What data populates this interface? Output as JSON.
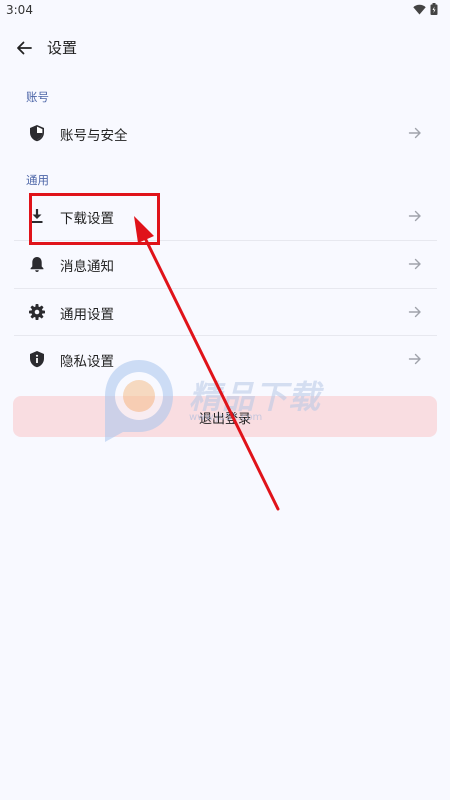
{
  "status_bar": {
    "time": "3:04",
    "icons": [
      "wifi-icon",
      "battery-icon"
    ]
  },
  "app_bar": {
    "back_icon": "arrow-left-icon",
    "title": "设置"
  },
  "sections": [
    {
      "header": "账号",
      "items": [
        {
          "label": "账号与安全",
          "icon": "shield-icon"
        }
      ]
    },
    {
      "header": "通用",
      "items": [
        {
          "label": "下载设置",
          "icon": "download-icon"
        },
        {
          "label": "消息通知",
          "icon": "bell-icon"
        },
        {
          "label": "通用设置",
          "icon": "gear-icon"
        },
        {
          "label": "隐私设置",
          "icon": "privacy-shield-icon"
        }
      ]
    }
  ],
  "logout": {
    "label": "退出登录"
  },
  "watermark": {
    "text": "精品下载",
    "url": "www.jb51.com"
  },
  "colors": {
    "background": "#f8f9ff",
    "section_header": "#4d66a8",
    "logout_bg": "#f9dde1",
    "annotation": "#e0131a"
  }
}
